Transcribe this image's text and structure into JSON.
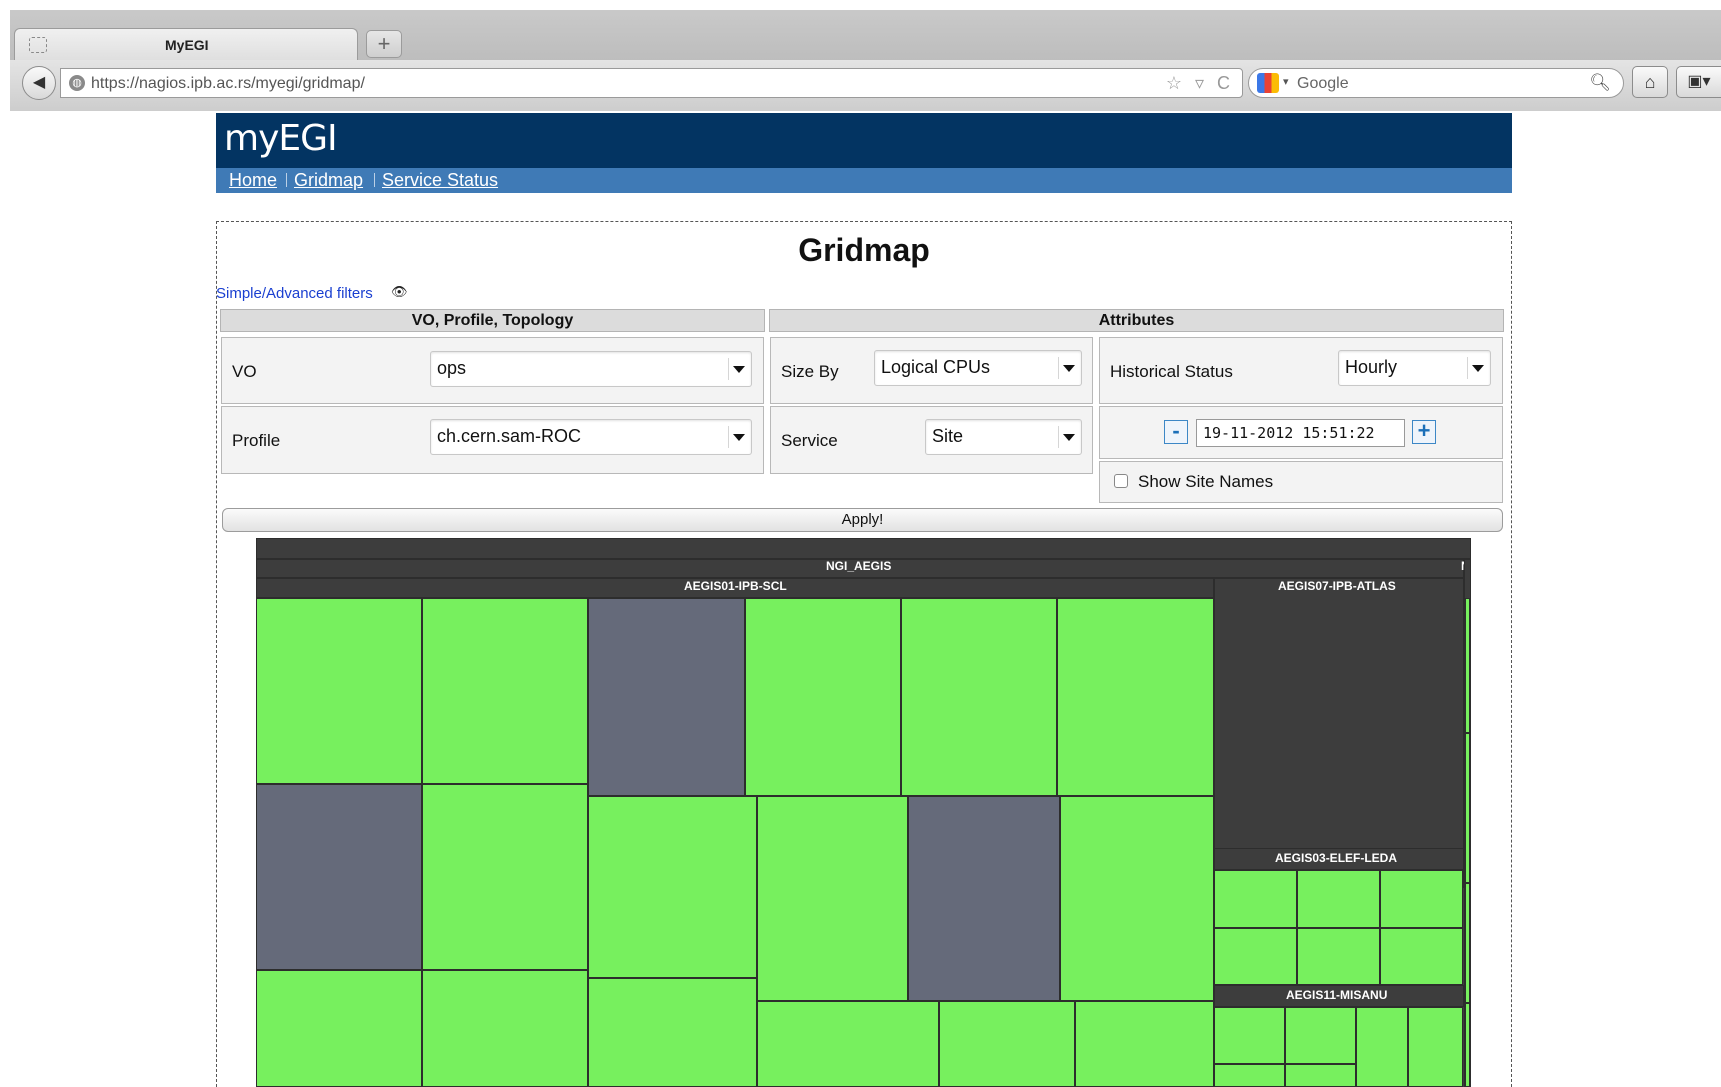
{
  "browser": {
    "tab_title": "MyEGI",
    "new_tab_label": "+",
    "url": "https://nagios.ipb.ac.rs/myegi/gridmap/",
    "url_icons": "☆ ▿ C",
    "search_placeholder": "Google"
  },
  "header": {
    "logo": "myEGI",
    "nav": [
      "Home",
      "Gridmap",
      "Service Status"
    ]
  },
  "main": {
    "title": "Gridmap",
    "filters_link": "Simple/Advanced filters"
  },
  "filters": {
    "section_vo_header": "VO, Profile, Topology",
    "section_attr_header": "Attributes",
    "vo_label": "VO",
    "vo_value": "ops",
    "profile_label": "Profile",
    "profile_value": "ch.cern.sam-ROC",
    "size_by_label": "Size By",
    "size_by_value": "Logical CPUs",
    "service_label": "Service",
    "service_value": "Site",
    "historical_label": "Historical Status",
    "historical_value": "Hourly",
    "minus_label": "-",
    "plus_label": "+",
    "datetime": "19-11-2012 15:51:22",
    "show_site_names_label": "Show Site Names",
    "show_site_names_checked": false,
    "apply_label": "Apply!"
  },
  "treemap": {
    "ngi_label": "NGI_AEGIS",
    "ngi2_label_fragment": "N",
    "ngi2_sub_fragment": "G",
    "site_labels": {
      "scl": "AEGIS01-IPB-SCL",
      "atlas": "AEGIS07-IPB-ATLAS",
      "leda": "AEGIS03-ELEF-LEDA",
      "misanu": "AEGIS11-MISANU"
    },
    "colors": {
      "ok": "#77f05e",
      "unknown": "#656a7a",
      "background": "#3d3d3d"
    }
  },
  "colors": {
    "header_dark": "#033462",
    "header_nav": "#3f7ab6",
    "link": "#1a3fd0"
  }
}
